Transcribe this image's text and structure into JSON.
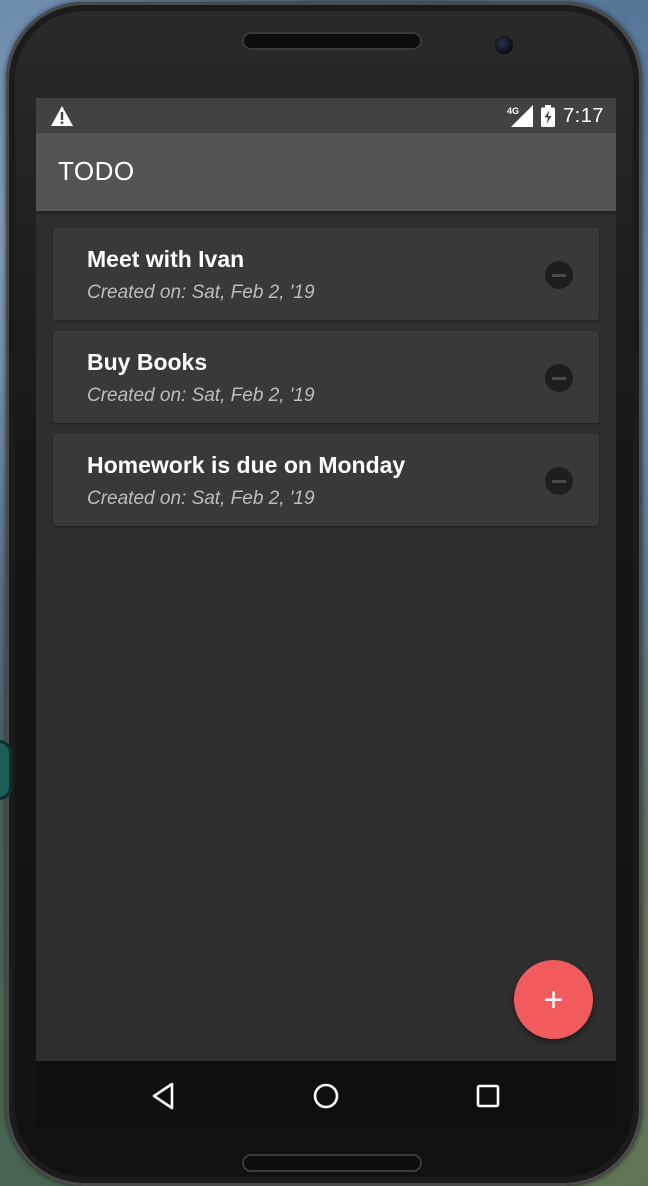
{
  "statusbar": {
    "warning_icon": "warning-icon",
    "network_label": "4G",
    "signal_icon": "cell-signal-icon",
    "battery_icon": "battery-charging-icon",
    "time": "7:17"
  },
  "appbar": {
    "title": "TODO"
  },
  "todos": [
    {
      "title": "Meet with Ivan",
      "subtitle": "Created on: Sat, Feb 2, '19"
    },
    {
      "title": "Buy Books",
      "subtitle": "Created on: Sat, Feb 2, '19"
    },
    {
      "title": "Homework is due on Monday",
      "subtitle": "Created on: Sat, Feb 2, '19"
    }
  ],
  "fab": {
    "label": "+",
    "icon": "add-icon"
  },
  "navbar": {
    "back_icon": "back-icon",
    "home_icon": "home-icon",
    "recents_icon": "recents-icon"
  },
  "colors": {
    "accent": "#f25b5b",
    "appbar": "#545454",
    "background": "#2e2e2e",
    "card": "#393939",
    "statusbar": "#424242"
  }
}
